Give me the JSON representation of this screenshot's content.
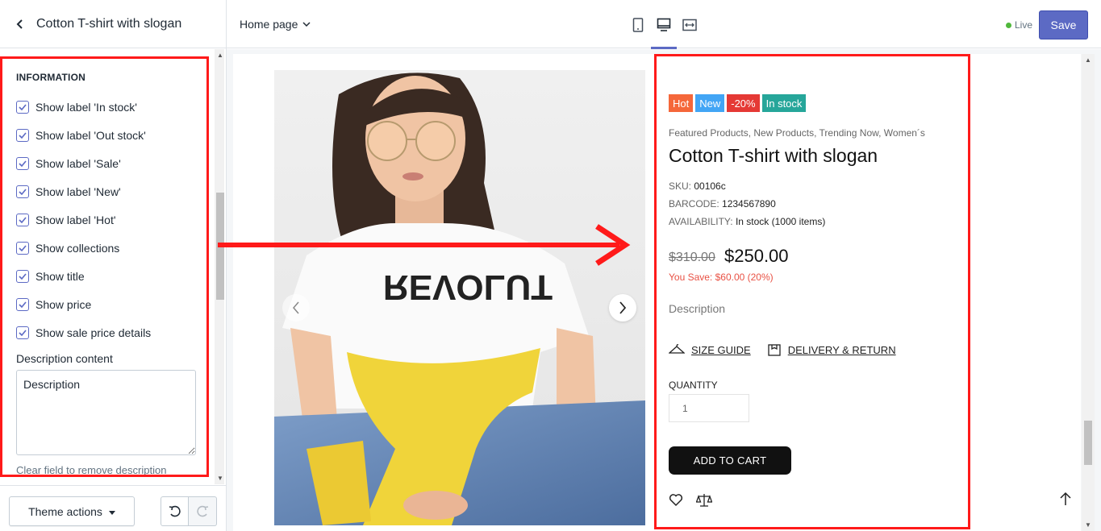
{
  "sidebar": {
    "title": "Cotton T-shirt with slogan",
    "section_heading": "INFORMATION",
    "checkboxes": [
      {
        "label": "Show label 'In stock'",
        "checked": true
      },
      {
        "label": "Show label 'Out stock'",
        "checked": true
      },
      {
        "label": "Show label 'Sale'",
        "checked": true
      },
      {
        "label": "Show label 'New'",
        "checked": true
      },
      {
        "label": "Show label 'Hot'",
        "checked": true
      },
      {
        "label": "Show collections",
        "checked": true
      },
      {
        "label": "Show title",
        "checked": true
      },
      {
        "label": "Show price",
        "checked": true
      },
      {
        "label": "Show sale price details",
        "checked": true
      }
    ],
    "description_label": "Description content",
    "description_value": "Description",
    "description_help": "Clear field to remove description",
    "theme_actions_label": "Theme actions"
  },
  "topbar": {
    "page_select": "Home page",
    "live_label": "Live",
    "save_label": "Save"
  },
  "product": {
    "badges": [
      {
        "label": "Hot",
        "color": "#f5673a"
      },
      {
        "label": "New",
        "color": "#42a5f5"
      },
      {
        "label": "-20%",
        "color": "#e53935"
      },
      {
        "label": "In stock",
        "color": "#26a69a"
      }
    ],
    "collections": "Featured Products, New Products, Trending Now, Women´s",
    "title": "Cotton T-shirt with slogan",
    "sku_label": "SKU:",
    "sku_value": "00106c",
    "barcode_label": "BARCODE:",
    "barcode_value": "1234567890",
    "availability_label": "AVAILABILITY:",
    "availability_value": "In stock (1000 items)",
    "old_price": "$310.00",
    "new_price": "$250.00",
    "you_save": "You Save: $60.00 (20%)",
    "description": "Description",
    "size_guide": "SIZE GUIDE",
    "delivery_return": "DELIVERY & RETURN",
    "quantity_label": "QUANTITY",
    "quantity_value": "1",
    "add_to_cart": "ADD TO CART",
    "tshirt_print": "REVOLUT"
  },
  "colors": {
    "accent": "#5c6ac4",
    "annotation_red": "#ff1a1a"
  }
}
